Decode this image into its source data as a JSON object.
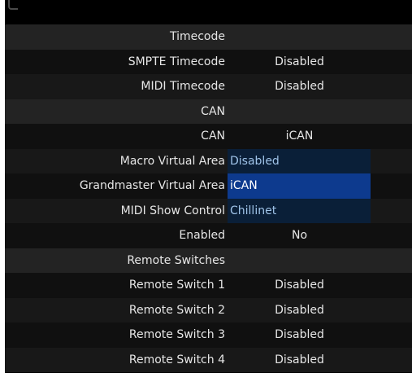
{
  "rows": [
    {
      "label": "Timecode",
      "value": "",
      "kind": "section"
    },
    {
      "label": "SMPTE Timecode",
      "value": "Disabled",
      "kind": "setting"
    },
    {
      "label": "MIDI Timecode",
      "value": "Disabled",
      "kind": "setting"
    },
    {
      "label": "CAN",
      "value": "",
      "kind": "section"
    },
    {
      "label": "CAN",
      "value": "iCAN",
      "kind": "setting"
    },
    {
      "label": "Macro Virtual Area",
      "value": "Disabled",
      "kind": "dropdown"
    },
    {
      "label": "Grandmaster Virtual Area",
      "value": "iCAN",
      "kind": "dropdown-selected"
    },
    {
      "label": "MIDI Show Control",
      "value": "Chillinet",
      "kind": "dropdown"
    },
    {
      "label": "Enabled",
      "value": "No",
      "kind": "setting"
    },
    {
      "label": "Remote Switches",
      "value": "",
      "kind": "section"
    },
    {
      "label": "Remote Switch 1",
      "value": "Disabled",
      "kind": "setting"
    },
    {
      "label": "Remote Switch 2",
      "value": "Disabled",
      "kind": "setting"
    },
    {
      "label": "Remote Switch 3",
      "value": "Disabled",
      "kind": "setting"
    },
    {
      "label": "Remote Switch 4",
      "value": "Disabled",
      "kind": "setting"
    }
  ],
  "colors": {
    "background": "#000000",
    "section_row": "#232323",
    "dropdown_bg": "#0a1f38",
    "dropdown_selected_bg": "#0d3a8e",
    "text": "#e6e6e6"
  }
}
